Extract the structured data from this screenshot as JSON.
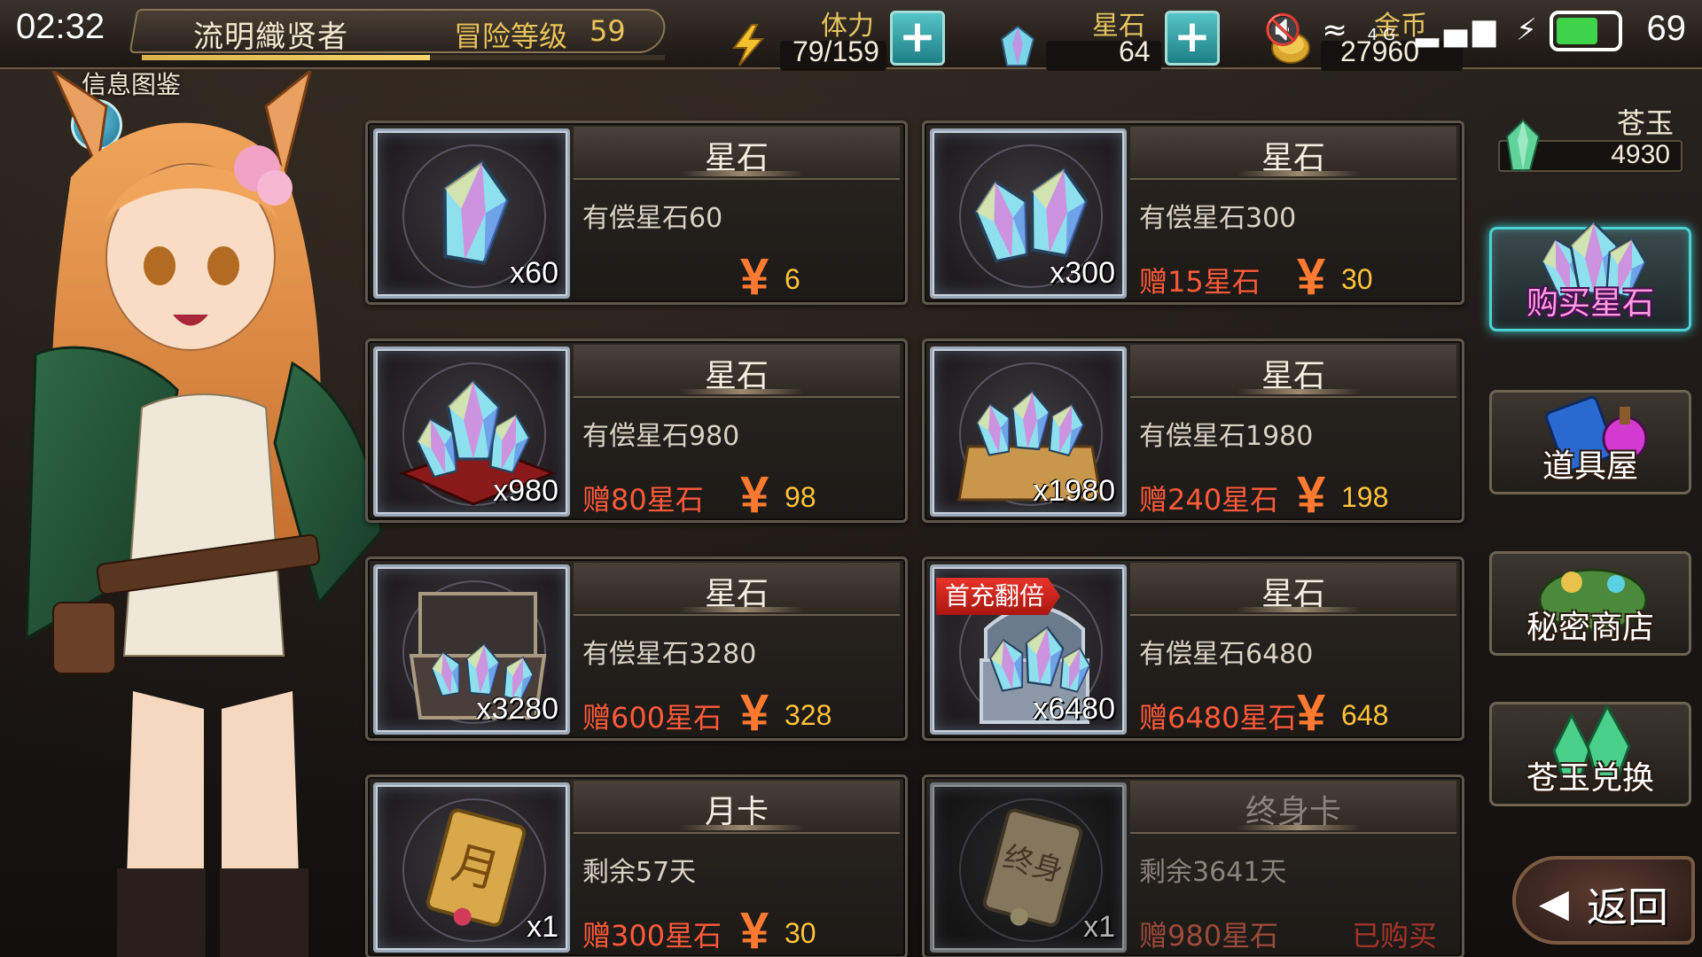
{
  "status_bar": {
    "time": "02:32",
    "network": "4G",
    "battery": "69",
    "battery_level": 0.69
  },
  "player": {
    "name": "流明織贤者",
    "level_label": "冒险等级",
    "level": "59",
    "exp_progress": 0.55
  },
  "resources": {
    "stamina": {
      "label": "体力",
      "value": "79/159",
      "add": "+"
    },
    "stars": {
      "label": "星石",
      "value": "64",
      "add": "+"
    },
    "gold": {
      "label": "金币",
      "value": "27960",
      "add": "+"
    }
  },
  "info": {
    "title": "信息图鉴",
    "help": "?"
  },
  "jade": {
    "label": "苍玉",
    "value": "4930"
  },
  "cards": [
    {
      "title": "星石",
      "desc": "有偿星石60",
      "bonus": "",
      "yen": "¥",
      "price": "6",
      "qty": "x60",
      "icon": "star-stone-single-icon"
    },
    {
      "title": "星石",
      "desc": "有偿星石300",
      "bonus": "赠15星石",
      "yen": "¥",
      "price": "30",
      "qty": "x300",
      "icon": "star-stone-pair-icon"
    },
    {
      "title": "星石",
      "desc": "有偿星石980",
      "bonus": "赠80星石",
      "yen": "¥",
      "price": "98",
      "qty": "x980",
      "icon": "star-stone-carpet-icon"
    },
    {
      "title": "星石",
      "desc": "有偿星石1980",
      "bonus": "赠240星石",
      "yen": "¥",
      "price": "198",
      "qty": "x1980",
      "icon": "star-stone-crate-icon"
    },
    {
      "title": "星石",
      "desc": "有偿星石3280",
      "bonus": "赠600星石",
      "yen": "¥",
      "price": "328",
      "qty": "x3280",
      "icon": "star-stone-chest-icon"
    },
    {
      "title": "星石",
      "desc": "有偿星石6480",
      "bonus": "赠6480星石",
      "yen": "¥",
      "price": "648",
      "qty": "x6480",
      "badge": "首充翻倍",
      "icon": "star-stone-treasure-icon"
    },
    {
      "title": "月卡",
      "desc": "剩余57天",
      "bonus": "赠300星石",
      "yen": "¥",
      "price": "30",
      "qty": "x1",
      "icon": "month-card-icon"
    },
    {
      "title": "终身卡",
      "desc": "剩余3641天",
      "bonus": "赠980星石",
      "status": "已购买",
      "qty": "x1",
      "icon": "lifetime-card-icon"
    }
  ],
  "side_menu": [
    {
      "label": "购买星石",
      "active": true,
      "icon": "star-stone-bundle-icon"
    },
    {
      "label": "道具屋",
      "active": false,
      "icon": "item-shop-icon"
    },
    {
      "label": "秘密商店",
      "active": false,
      "icon": "secret-shop-icon"
    },
    {
      "label": "苍玉兑换",
      "active": false,
      "icon": "jade-exchange-icon"
    }
  ],
  "back": {
    "label": "返回",
    "arrow": "◀"
  },
  "colors": {
    "accent_teal": "#3bc6c8",
    "bonus_red": "#ff5a3a",
    "price_gold": "#ffc23a",
    "yen_orange": "#ff7a30"
  }
}
